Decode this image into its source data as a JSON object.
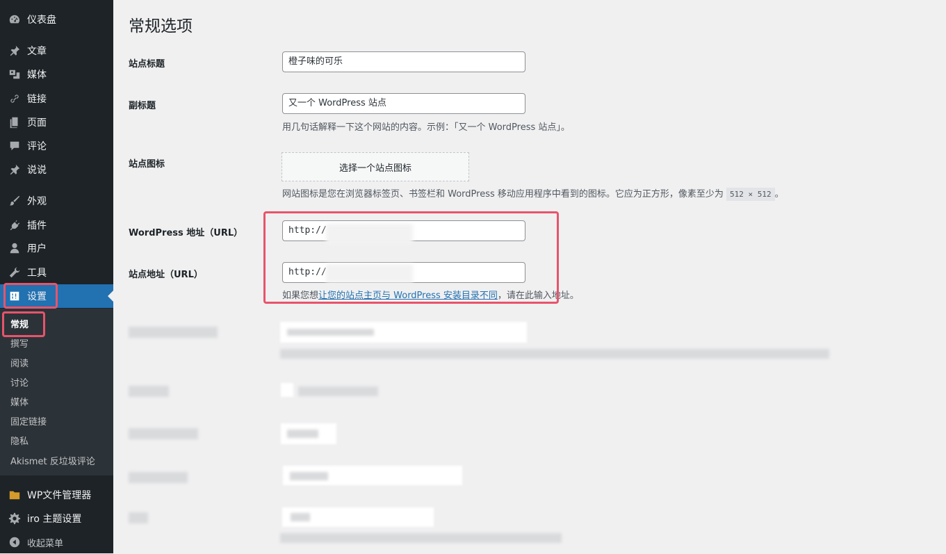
{
  "sidebar": {
    "items": [
      {
        "label": "仪表盘",
        "icon": "dashboard-icon"
      },
      {
        "label": "文章",
        "icon": "pin-icon"
      },
      {
        "label": "媒体",
        "icon": "media-icon"
      },
      {
        "label": "链接",
        "icon": "link-icon"
      },
      {
        "label": "页面",
        "icon": "page-icon"
      },
      {
        "label": "评论",
        "icon": "comment-icon"
      },
      {
        "label": "说说",
        "icon": "pin-icon"
      },
      {
        "label": "外观",
        "icon": "brush-icon"
      },
      {
        "label": "插件",
        "icon": "plugin-icon"
      },
      {
        "label": "用户",
        "icon": "user-icon"
      },
      {
        "label": "工具",
        "icon": "wrench-icon"
      },
      {
        "label": "设置",
        "icon": "settings-icon"
      }
    ],
    "submenu": [
      "常规",
      "撰写",
      "阅读",
      "讨论",
      "媒体",
      "固定链接",
      "隐私",
      "Akismet 反垃圾评论"
    ],
    "extra": [
      {
        "label": "WP文件管理器",
        "icon": "folder-icon"
      },
      {
        "label": "iro 主题设置",
        "icon": "gear-icon"
      },
      {
        "label": "收起菜单",
        "icon": "collapse-icon"
      }
    ]
  },
  "page": {
    "title": "常规选项",
    "site_title": {
      "label": "站点标题",
      "value": "橙子味的可乐"
    },
    "tagline": {
      "label": "副标题",
      "value": "又一个 WordPress 站点",
      "desc": "用几句话解释一下这个网站的内容。示例：「又一个 WordPress 站点」。"
    },
    "site_icon": {
      "label": "站点图标",
      "button": "选择一个站点图标",
      "desc_pre": "网站图标是您在浏览器标签页、书签栏和 WordPress 移动应用程序中看到的图标。它应为正方形，像素至少为 ",
      "desc_code": "512 × 512",
      "desc_post": "。"
    },
    "wp_url": {
      "label": "WordPress 地址（URL）",
      "value": "http://"
    },
    "site_url": {
      "label": "站点地址（URL）",
      "value": "http://"
    },
    "url_desc": {
      "pre": "如果您想",
      "link": "让您的站点主页与 WordPress 安装目录不同",
      "post": "，请在此输入地址。"
    }
  },
  "colors": {
    "sidebar": "#1d2327",
    "submenu": "#2c3338",
    "active": "#2271b1",
    "highlight": "#e8546b",
    "background": "#f0f0f1"
  }
}
